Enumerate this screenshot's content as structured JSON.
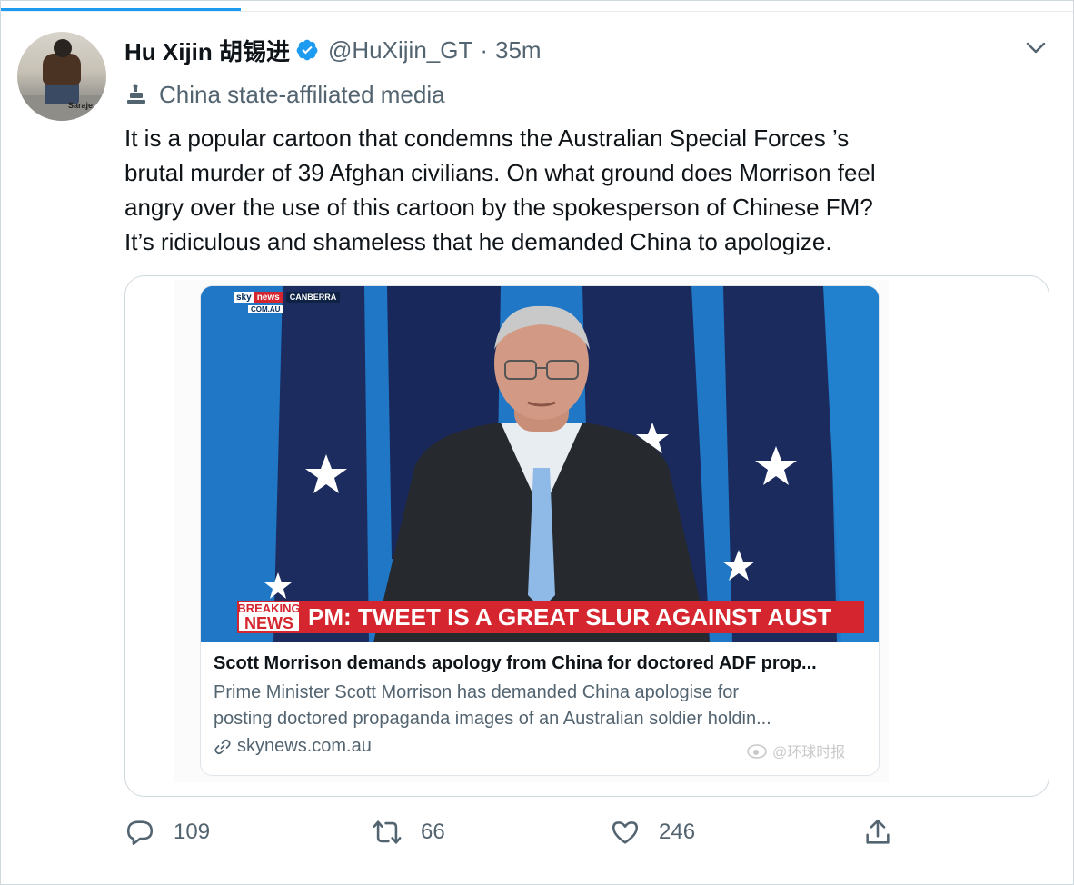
{
  "tweet": {
    "author": {
      "display_name": "Hu Xijin 胡锡进",
      "handle": "@HuXijin_GT",
      "avatar_caption": "Saraje",
      "verified": true
    },
    "separator": "·",
    "time": "35m",
    "affiliation_label": "China state-affiliated media",
    "text": "It is a popular cartoon that condemns the Australian Special Forces ’s\nbrutal murder of 39 Afghan civilians. On what ground does Morrison feel\nangry over the use of this cartoon by the spokesperson of Chinese FM?\nIt’s ridiculous and shameless that he demanded China to apologize.",
    "media": {
      "broadcast": {
        "logo_sky": "sky",
        "logo_news": "news",
        "logo_city": "CANBERRA",
        "logo_domain": "COM.AU",
        "breaking_line1": "BREAKING",
        "breaking_line2": "NEWS",
        "headline": "PM: TWEET IS A GREAT SLUR AGAINST AUST"
      },
      "link_card": {
        "title": "Scott Morrison demands apology from China for doctored ADF prop...",
        "description": "Prime Minister Scott Morrison has demanded China apologise for\nposting doctored propaganda images of an Australian soldier holdin...",
        "domain": "skynews.com.au"
      },
      "watermark": "@环球时报"
    },
    "actions": {
      "replies": "109",
      "retweets": "66",
      "likes": "246"
    }
  },
  "colors": {
    "accent": "#1d9bf0",
    "text_primary": "#0f1419",
    "text_secondary": "#536471",
    "border": "#cfd9de",
    "breaking_red": "#d5262f"
  },
  "icons": [
    "verified-badge-icon",
    "chevron-down-icon",
    "state-media-icon",
    "link-icon",
    "reply-icon",
    "retweet-icon",
    "like-icon",
    "share-icon"
  ]
}
